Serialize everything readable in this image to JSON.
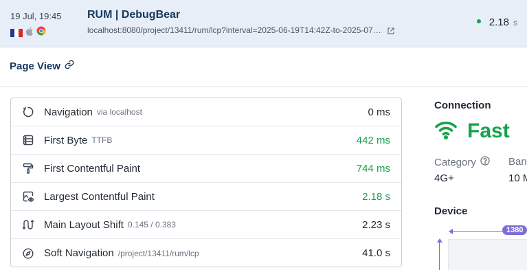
{
  "header": {
    "date": "19 Jul, 19:45",
    "title": "RUM | DebugBear",
    "url": "localhost:8080/project/13411/rum/lcp?interval=2025-06-19T14:42Z-to-2025-07…",
    "metric_value": "2.18",
    "metric_unit": "s",
    "status_color": "#16a34a",
    "icons": [
      "france-flag-icon",
      "apple-icon",
      "chrome-icon",
      "external-link-icon"
    ]
  },
  "page_view": {
    "title": "Page View",
    "icon": "link-icon"
  },
  "timings": [
    {
      "icon": "navigation-icon",
      "label": "Navigation",
      "sub": "via localhost",
      "value": "0 ms",
      "status": "neutral"
    },
    {
      "icon": "server-icon",
      "label": "First Byte",
      "sub": "TTFB",
      "value": "442 ms",
      "status": "good"
    },
    {
      "icon": "paint-roller-icon",
      "label": "First Contentful Paint",
      "sub": "",
      "value": "744 ms",
      "status": "good"
    },
    {
      "icon": "image-eye-icon",
      "label": "Largest Contentful Paint",
      "sub": "",
      "value": "2.18 s",
      "status": "good"
    },
    {
      "icon": "layout-shift-icon",
      "label": "Main Layout Shift",
      "sub": "0.145 / 0.383",
      "value": "2.23 s",
      "status": "neutral"
    },
    {
      "icon": "compass-icon",
      "label": "Soft Navigation",
      "sub": "/project/13411/rum/lcp",
      "value": "41.0 s",
      "status": "neutral"
    }
  ],
  "connection": {
    "title": "Connection",
    "speed": "Fast",
    "icon": "wifi-icon",
    "category_label": "Category",
    "category_value": "4G+",
    "bandwidth_label": "Ban",
    "bandwidth_value": "10 M"
  },
  "device": {
    "title": "Device",
    "width_badge": "1380"
  },
  "colors": {
    "good": "#16a34a",
    "accent": "#7c6fd6",
    "header_bg": "#e7eef8",
    "title": "#17375e"
  }
}
